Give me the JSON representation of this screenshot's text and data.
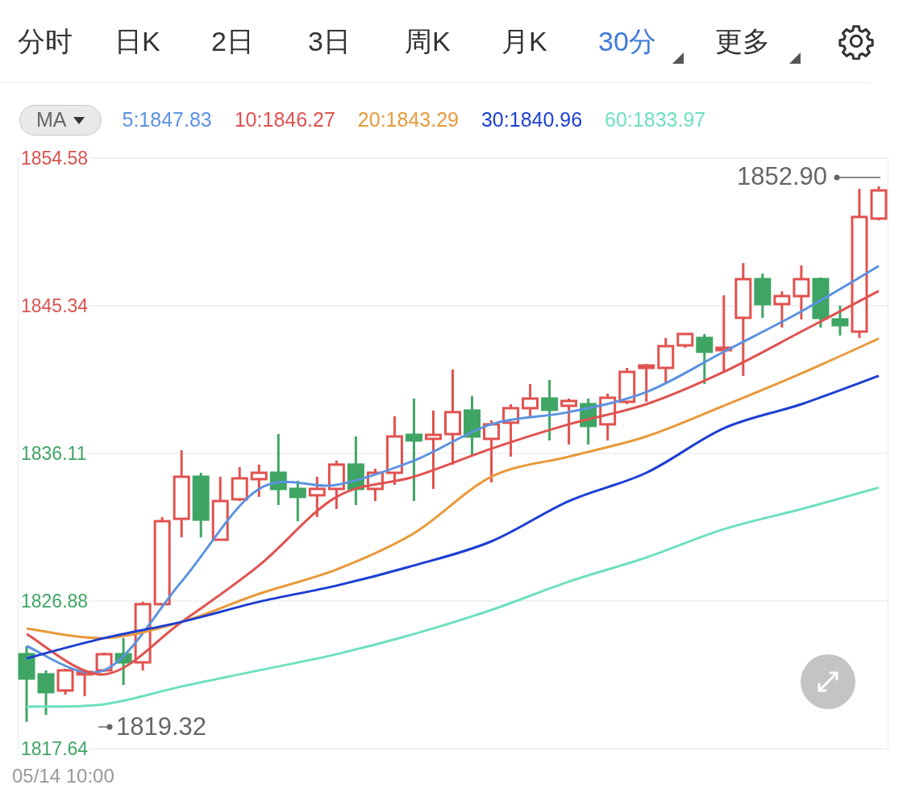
{
  "tabs": [
    {
      "label": "分时",
      "selected": false,
      "has_menu": false
    },
    {
      "label": "日K",
      "selected": false,
      "has_menu": false
    },
    {
      "label": "2日",
      "selected": false,
      "has_menu": false
    },
    {
      "label": "3日",
      "selected": false,
      "has_menu": false
    },
    {
      "label": "周K",
      "selected": false,
      "has_menu": false
    },
    {
      "label": "月K",
      "selected": false,
      "has_menu": false
    },
    {
      "label": "30分",
      "selected": true,
      "has_menu": true
    },
    {
      "label": "更多",
      "selected": false,
      "has_menu": true
    }
  ],
  "indicator_select": {
    "label": "MA"
  },
  "chart": {
    "chart_data": {
      "type": "line",
      "categories": [
        null,
        null,
        null,
        null,
        null,
        null,
        null,
        null,
        null,
        null,
        null,
        null
      ],
      "ylim": [
        1817.64,
        1854.58
      ],
      "grid": true,
      "yticks": [
        {
          "value": 1854.58,
          "label": "1854.58"
        },
        {
          "value": 1845.34,
          "label": "1845.34"
        },
        {
          "value": 1836.11,
          "label": "1836.11"
        },
        {
          "value": 1826.88,
          "label": "1826.88"
        },
        {
          "value": 1817.64,
          "label": "1817.64"
        }
      ],
      "series": [
        {
          "name": "5:1847.83",
          "color": "#5b93e0",
          "values": [
            1824.05,
            1822.54,
            1828.09,
            1833.89,
            1834.14,
            1835.66,
            1837.93,
            1838.69,
            1839.95,
            1842.47,
            1844.99,
            1847.83
          ]
        },
        {
          "name": "10:1846.27",
          "color": "#e0524f",
          "values": [
            1824.81,
            1822.29,
            1825.57,
            1829.1,
            1833.39,
            1834.65,
            1836.41,
            1837.93,
            1839.19,
            1841.21,
            1843.73,
            1846.27
          ]
        },
        {
          "name": "20:1843.29",
          "color": "#e89a3c",
          "values": [
            1825.16,
            1824.56,
            1825.57,
            1827.33,
            1828.85,
            1831.12,
            1834.65,
            1835.91,
            1837.17,
            1839.09,
            1841.11,
            1843.29
          ]
        },
        {
          "name": "30:1840.96",
          "color": "#1c3fd4",
          "values": [
            1823.29,
            1824.56,
            1825.57,
            1826.83,
            1827.84,
            1829.1,
            1830.61,
            1833.13,
            1834.9,
            1837.68,
            1839.19,
            1840.96
          ]
        },
        {
          "name": "60:1833.97",
          "color": "#6ee0c0",
          "values": [
            1820.27,
            1820.42,
            1821.53,
            1822.54,
            1823.55,
            1824.81,
            1826.32,
            1828.09,
            1829.6,
            1831.37,
            1832.63,
            1833.97
          ]
        }
      ]
    },
    "price_markers": [
      {
        "kind": "last",
        "label": "1852.90"
      },
      {
        "kind": "low",
        "label": "1819.32"
      }
    ]
  },
  "x_axis_start_label": "05/14 10:00"
}
